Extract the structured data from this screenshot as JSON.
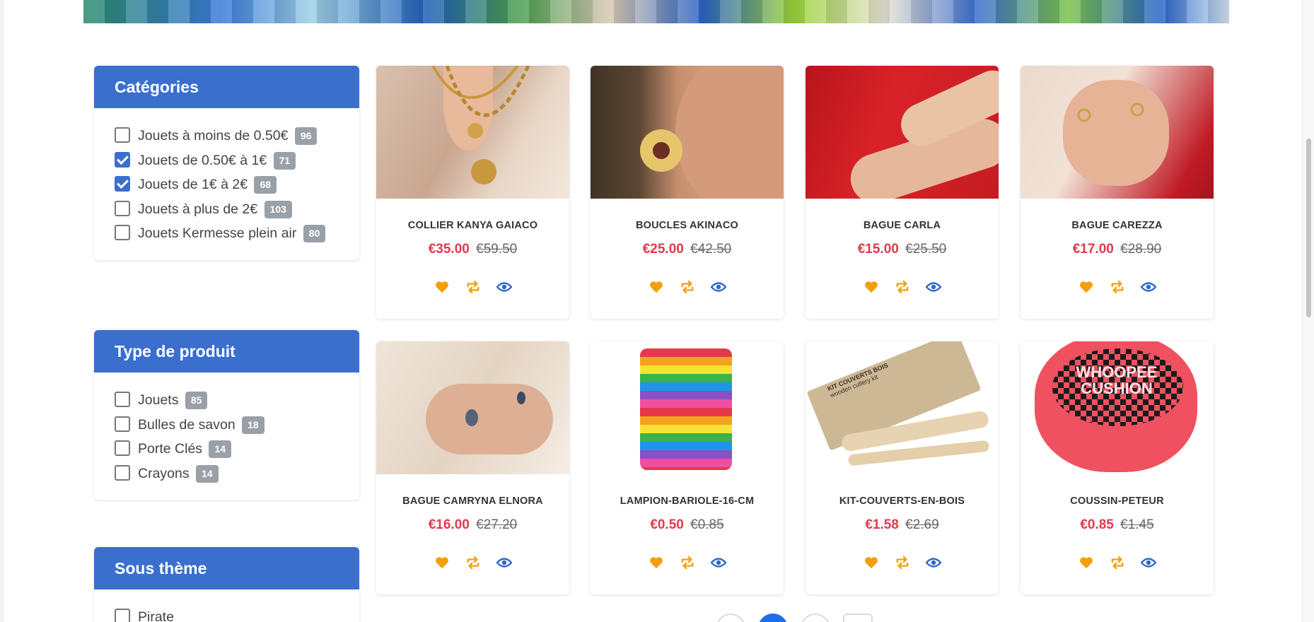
{
  "filters": {
    "categories": {
      "title": "Catégories",
      "items": [
        {
          "label": "Jouets à moins de 0.50€",
          "count": "96",
          "checked": false
        },
        {
          "label": "Jouets de 0.50€ à 1€",
          "count": "71",
          "checked": true
        },
        {
          "label": "Jouets de 1€ à 2€",
          "count": "68",
          "checked": true
        },
        {
          "label": "Jouets à plus de 2€",
          "count": "103",
          "checked": false
        },
        {
          "label": "Jouets Kermesse plein air",
          "count": "80",
          "checked": false
        }
      ]
    },
    "product_type": {
      "title": "Type de produit",
      "items": [
        {
          "label": "Jouets",
          "count": "85",
          "checked": false
        },
        {
          "label": "Bulles de savon",
          "count": "18",
          "checked": false
        },
        {
          "label": "Porte Clés",
          "count": "14",
          "checked": false
        },
        {
          "label": "Crayons",
          "count": "14",
          "checked": false
        }
      ]
    },
    "sub_theme": {
      "title": "Sous thème",
      "items": [
        {
          "label": "Pirate",
          "count": "",
          "checked": false
        }
      ]
    }
  },
  "products": [
    {
      "name": "COLLIER KANYA GAIACO",
      "price": "€35.00",
      "old_price": "€59.50"
    },
    {
      "name": "BOUCLES AKINACO",
      "price": "€25.00",
      "old_price": "€42.50"
    },
    {
      "name": "BAGUE CARLA",
      "price": "€15.00",
      "old_price": "€25.50"
    },
    {
      "name": "BAGUE CAREZZA",
      "price": "€17.00",
      "old_price": "€28.90"
    },
    {
      "name": "BAGUE CAMRYNA ELNORA",
      "price": "€16.00",
      "old_price": "€27.20"
    },
    {
      "name": "LAMPION-BARIOLE-16-CM",
      "price": "€0.50",
      "old_price": "€0.85"
    },
    {
      "name": "KIT-COUVERTS-EN-BOIS",
      "price": "€1.58",
      "old_price": "€2.69"
    },
    {
      "name": "COUSSIN-PETEUR",
      "price": "€0.85",
      "old_price": "€1.45"
    }
  ],
  "product_images": {
    "cutlery_print": "KIT COUVERTS BOIS",
    "cutlery_print_sub": "wooden cutlery kit",
    "cushion_print_1": "WHOOPEE",
    "cushion_print_2": "CUSHION"
  },
  "icons": {
    "wishlist": "heart-icon",
    "compare": "compare-icon",
    "quickview": "eye-icon"
  },
  "colors": {
    "accent": "#3a6fce",
    "price": "#e03a4d",
    "wishlist": "#f59e0b",
    "pager_active": "#1e6ee8"
  }
}
